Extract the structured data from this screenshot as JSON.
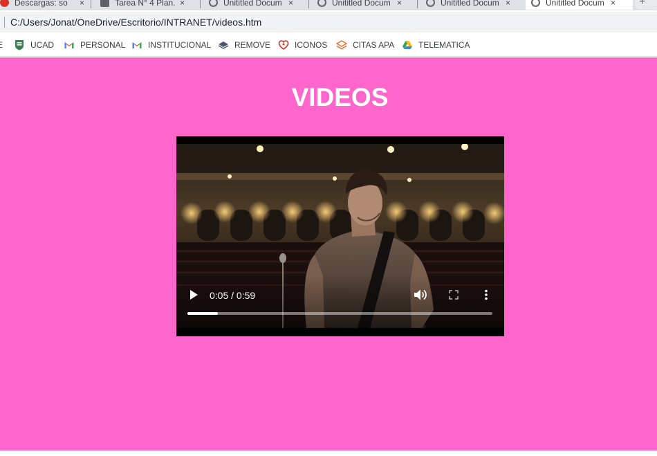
{
  "browser": {
    "tabs": [
      {
        "title": "Descargas: so",
        "icon": "download-icon",
        "active": false
      },
      {
        "title": "Tarea N° 4 Plan..",
        "icon": "document-icon",
        "active": false
      },
      {
        "title": "Unititled Docum",
        "icon": "globe-icon",
        "active": false
      },
      {
        "title": "Unititled Docum",
        "icon": "globe-icon",
        "active": false
      },
      {
        "title": "Unititled Docum",
        "icon": "globe-icon",
        "active": false
      },
      {
        "title": "Unititled Docum",
        "icon": "globe-icon",
        "active": true
      }
    ],
    "tab_close_glyph": "×",
    "new_tab_glyph": "+",
    "address": "C:/Users/Jonat/OneDrive/Escritorio/INTRANET/videos.htm",
    "bookmarks": [
      {
        "label": "E",
        "icon": "",
        "color": "#5f6368"
      },
      {
        "label": "UCAD",
        "icon": "shield-icon",
        "color": "#3e7d4f"
      },
      {
        "label": "PERSONAL",
        "icon": "gmail-icon",
        "color": "#d93025"
      },
      {
        "label": "INSTITUCIONAL",
        "icon": "gmail-icon",
        "color": "#d93025"
      },
      {
        "label": "REMOVE",
        "icon": "layers-icon",
        "color": "#4a5568"
      },
      {
        "label": "ICONOS",
        "icon": "heart-outline-icon",
        "color": "#d93025"
      },
      {
        "label": "CITAS APA",
        "icon": "stack-icon",
        "color": "#e8702a"
      },
      {
        "label": "TELEMATICA",
        "icon": "google-drive-icon",
        "color": "#1a73e8"
      }
    ]
  },
  "page": {
    "background": "#ff66cc",
    "title": "VIDEOS",
    "video": {
      "time_display": "0:05 / 0:59",
      "progress": 0.1,
      "controls": [
        "play-icon",
        "volume-icon",
        "fullscreen-icon",
        "more-options-icon"
      ]
    }
  }
}
